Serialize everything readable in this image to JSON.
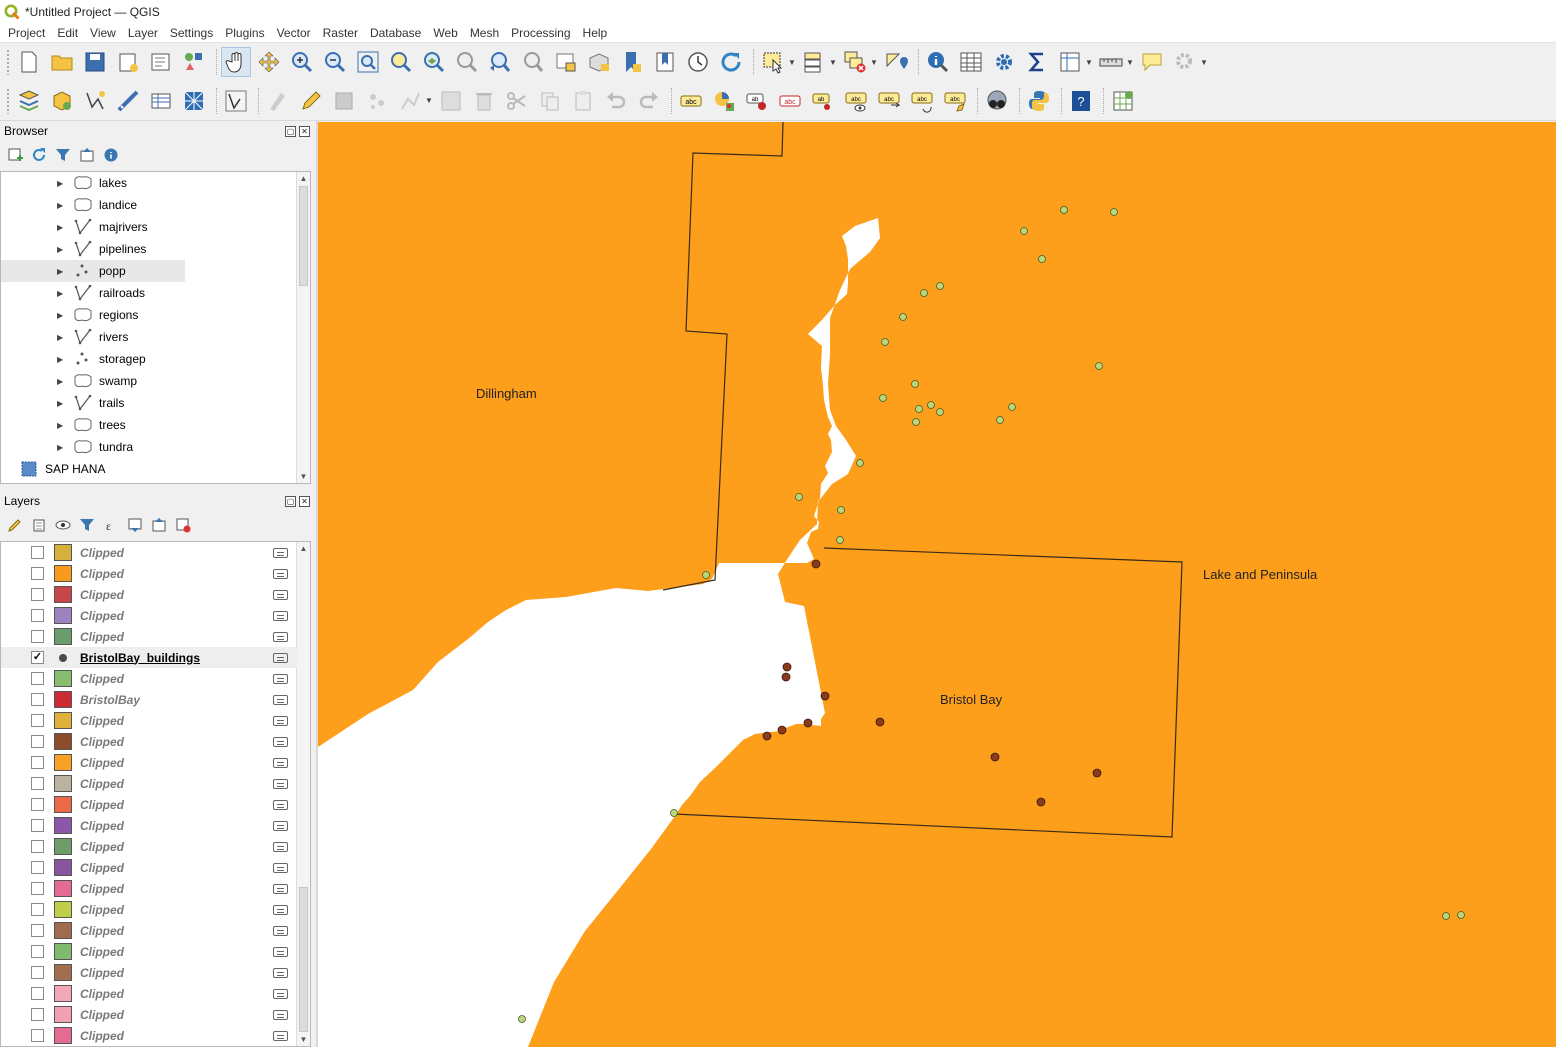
{
  "window": {
    "title": "*Untitled Project — QGIS"
  },
  "menu": [
    "Project",
    "Edit",
    "View",
    "Layer",
    "Settings",
    "Plugins",
    "Vector",
    "Raster",
    "Database",
    "Web",
    "Mesh",
    "Processing",
    "Help"
  ],
  "browser": {
    "title": "Browser",
    "items": [
      {
        "label": "lakes",
        "kind": "polygon"
      },
      {
        "label": "landice",
        "kind": "polygon"
      },
      {
        "label": "majrivers",
        "kind": "line"
      },
      {
        "label": "pipelines",
        "kind": "line"
      },
      {
        "label": "popp",
        "kind": "point",
        "selected": true
      },
      {
        "label": "railroads",
        "kind": "line"
      },
      {
        "label": "regions",
        "kind": "polygon"
      },
      {
        "label": "rivers",
        "kind": "line"
      },
      {
        "label": "storagep",
        "kind": "point"
      },
      {
        "label": "swamp",
        "kind": "polygon"
      },
      {
        "label": "trails",
        "kind": "line"
      },
      {
        "label": "trees",
        "kind": "polygon"
      },
      {
        "label": "tundra",
        "kind": "polygon"
      }
    ],
    "root_item": "SAP HANA"
  },
  "layers": {
    "title": "Layers",
    "items": [
      {
        "name": "Clipped",
        "color": "#d4b13a",
        "checked": false
      },
      {
        "name": "Clipped",
        "color": "#f99a1c",
        "checked": false
      },
      {
        "name": "Clipped",
        "color": "#c8454a",
        "checked": false
      },
      {
        "name": "Clipped",
        "color": "#9d82c0",
        "checked": false
      },
      {
        "name": "Clipped",
        "color": "#6b9c6b",
        "checked": false
      },
      {
        "name": "BristolBay_buildings",
        "color": "#4b4b4b",
        "checked": true,
        "active": true,
        "symbol": "point"
      },
      {
        "name": "Clipped",
        "color": "#86bd6e",
        "checked": false
      },
      {
        "name": "BristolBay",
        "color": "#cc2b35",
        "checked": false
      },
      {
        "name": "Clipped",
        "color": "#dfb13a",
        "checked": false
      },
      {
        "name": "Clipped",
        "color": "#8d4c2b",
        "checked": false
      },
      {
        "name": "Clipped",
        "color": "#f7a126",
        "checked": false
      },
      {
        "name": "Clipped",
        "color": "#bcb39f",
        "checked": false
      },
      {
        "name": "Clipped",
        "color": "#ec6a45",
        "checked": false
      },
      {
        "name": "Clipped",
        "color": "#8c57a8",
        "checked": false
      },
      {
        "name": "Clipped",
        "color": "#6e9c6a",
        "checked": false
      },
      {
        "name": "Clipped",
        "color": "#8a55a0",
        "checked": false
      },
      {
        "name": "Clipped",
        "color": "#e56a95",
        "checked": false
      },
      {
        "name": "Clipped",
        "color": "#bfcf4a",
        "checked": false
      },
      {
        "name": "Clipped",
        "color": "#a16b50",
        "checked": false
      },
      {
        "name": "Clipped",
        "color": "#7fba6e",
        "checked": false
      },
      {
        "name": "Clipped",
        "color": "#a36e50",
        "checked": false
      },
      {
        "name": "Clipped",
        "color": "#f3a8b8",
        "checked": false
      },
      {
        "name": "Clipped",
        "color": "#f3a0b2",
        "checked": false
      },
      {
        "name": "Clipped",
        "color": "#e46c90",
        "checked": false
      }
    ]
  },
  "map": {
    "background_color": "#fe9f1b",
    "water_color": "#ffffff",
    "labels": {
      "dillingham": "Dillingham",
      "bristol_bay": "Bristol Bay",
      "lake_peninsula": "Lake and Peninsula"
    },
    "popp_point_color": "#b9d77a",
    "building_point_color": "#8a3b1e"
  }
}
